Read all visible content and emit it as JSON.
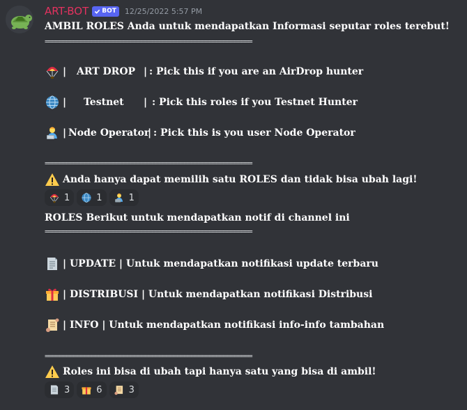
{
  "author": {
    "username": "ART-BOT",
    "bot_tag": "BOT",
    "timestamp": "12/25/2022 5:57 PM",
    "avatar_icon": "turtle-icon"
  },
  "colors": {
    "background": "#313338",
    "username": "#e3325f",
    "bot_tag": "#5865f2",
    "reaction_bg": "#2b2d31",
    "timestamp": "#949ba4"
  },
  "message": {
    "intro": "AMBIL ROLES Anda untuk mendapatkan Informasi seputar roles terebut!",
    "separator": "==========================================================",
    "roles": [
      {
        "icon": "parachute-icon",
        "pre": "|",
        "name": "ART DROP",
        "mid": "|",
        "desc": ": Pick this if you are an AirDrop hunter"
      },
      {
        "icon": "globe-icon",
        "pre": "|",
        "name": "Testnet",
        "mid": "|",
        "desc": ": Pick this roles if you Testnet Hunter"
      },
      {
        "icon": "technologist-icon",
        "pre": "|",
        "name": "Node Operator",
        "mid": "|",
        "desc": ": Pick this is you user Node Operator"
      }
    ],
    "warning1": "Anda hanya dapat memilih satu ROLES dan tidak bisa ubah lagi!",
    "reactions1": [
      {
        "icon": "parachute-icon",
        "count": "1"
      },
      {
        "icon": "globe-icon",
        "count": "1"
      },
      {
        "icon": "technologist-icon",
        "count": "1"
      }
    ],
    "intro2": "ROLES Berikut untuk mendapatkan notif di channel ini",
    "notifs": [
      {
        "icon": "page-icon",
        "text": "| UPDATE | Untuk mendapatkan notifikasi update terbaru"
      },
      {
        "icon": "gift-icon",
        "text": "| DISTRIBUSI | Untuk mendapatkan notifikasi Distribusi"
      },
      {
        "icon": "scroll-icon",
        "text": "| INFO | Untuk mendapatkan notifikasi info-info tambahan"
      }
    ],
    "warning2": "Roles ini bisa di ubah tapi hanya satu yang bisa di ambil!",
    "reactions2": [
      {
        "icon": "page-icon",
        "count": "3"
      },
      {
        "icon": "gift-icon",
        "count": "6"
      },
      {
        "icon": "scroll-icon",
        "count": "3"
      }
    ]
  }
}
